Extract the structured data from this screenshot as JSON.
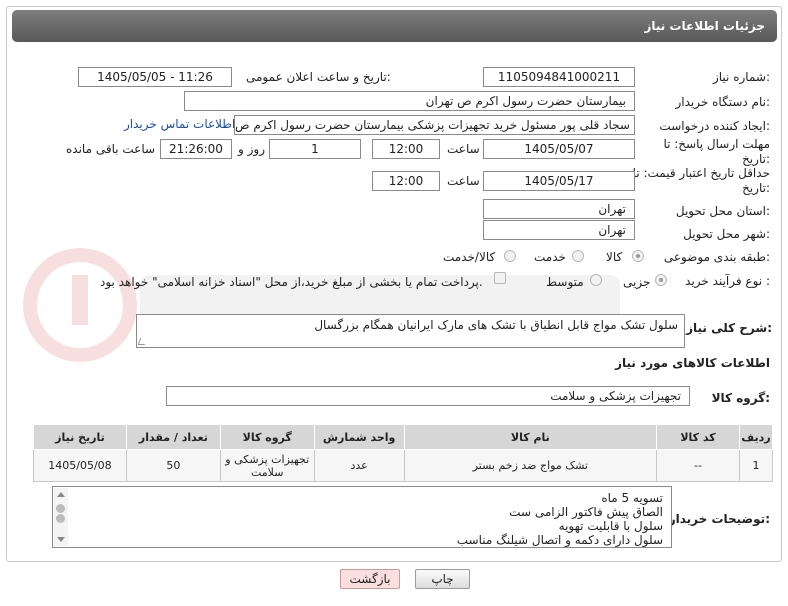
{
  "header": {
    "title": "جزئیات اطلاعات نیاز"
  },
  "fields": {
    "need_number_label": "شماره نیاز:",
    "need_number": "1105094841000211",
    "announce_label": "تاریخ و ساعت اعلان عمومی:",
    "announce_value": "1405/05/05 - 11:26",
    "buyer_org_label": "نام دستگاه خریدار:",
    "buyer_org": "بیمارستان حضرت رسول اکرم ص  تهران",
    "creator_label": "ایجاد کننده درخواست:",
    "creator": "سجاد قلی پور مسئول خرید تجهیزات پزشکی  بیمارستان حضرت رسول اکرم ص",
    "contact_link": "اطلاعات تماس خریدار",
    "reply_deadline_label": "مهلت ارسال پاسخ: تا تاریخ:",
    "reply_date": "1405/05/07",
    "time_label": "ساعت",
    "reply_time": "12:00",
    "days": "1",
    "day_and_label": "روز و",
    "remaining_time": "21:26:00",
    "remaining_label": "ساعت باقی مانده",
    "price_deadline_label": "حداقل تاریخ اعتبار قیمت: تا تاریخ:",
    "price_date": "1405/05/17",
    "price_time": "12:00",
    "province_label": "استان محل تحویل:",
    "province": "تهران",
    "city_label": "شهر محل تحویل:",
    "city": "تهران",
    "category_label": "طبقه بندی موضوعی:",
    "category_options": [
      "کالا",
      "خدمت",
      "کالا/خدمت"
    ],
    "process_label": "نوع فرآیند خرید :",
    "process_options": [
      "جزیی",
      "متوسط"
    ],
    "payment_note": "پرداخت تمام یا بخشی از مبلغ خرید،از محل \"اسناد خزانه اسلامی\" خواهد بود."
  },
  "description": {
    "label": "شرح کلی نیاز:",
    "text": "سلول تشک مواج قابل انطباق با تشک های مارک ایرانیان همگام بزرگسال"
  },
  "goods_section": {
    "title": "اطلاعات کالاهای مورد نیاز",
    "group_label": "گروه کالا:",
    "group_value": "تجهیزات پزشکی و سلامت",
    "columns": [
      "ردیف",
      "کد کالا",
      "نام کالا",
      "واحد شمارش",
      "گروه کالا",
      "تعداد / مقدار",
      "تاریخ نیاز"
    ],
    "rows": [
      {
        "row": "1",
        "code": "--",
        "name": "تشک مواج ضد زخم بستر",
        "unit": "عدد",
        "group": "تجهیزات پزشکی و سلامت",
        "qty": "50",
        "date": "1405/05/08"
      }
    ]
  },
  "buyer_notes": {
    "label": "توضیحات خریدار:",
    "lines": [
      "تسویه 5 ماه",
      "الصاق پیش فاکتور الزامی ست",
      "سلول با قابلیت تهویه",
      "سلول دارای دکمه و اتصال شیلنگ مناسب"
    ]
  },
  "buttons": {
    "print": "چاپ",
    "back": "بازگشت"
  },
  "colors": {
    "header": "#6b6b6b",
    "link": "#1a4fa0",
    "back_button": "#fbdede"
  }
}
